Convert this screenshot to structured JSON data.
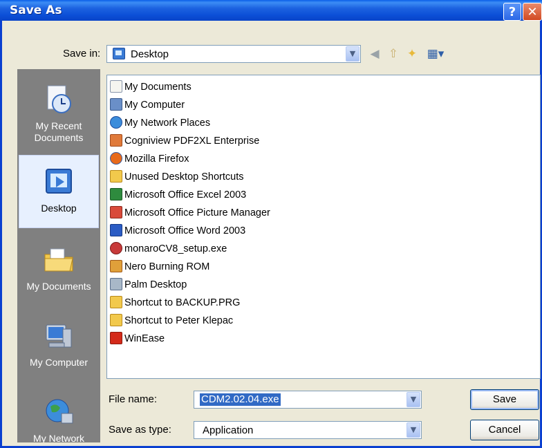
{
  "window": {
    "title": "Save As",
    "help_glyph": "?",
    "close_glyph": "✕"
  },
  "toolbar": {
    "save_in_label": "Save in:",
    "save_in_value": "Desktop",
    "icons": [
      "back-icon",
      "up-folder-icon",
      "new-folder-icon",
      "views-menu-icon"
    ]
  },
  "places": [
    {
      "label": "My Recent Documents",
      "icon": "recent-documents-icon"
    },
    {
      "label": "Desktop",
      "icon": "desktop-icon",
      "selected": true
    },
    {
      "label": "My Documents",
      "icon": "my-documents-icon"
    },
    {
      "label": "My Computer",
      "icon": "my-computer-icon"
    },
    {
      "label": "My Network",
      "icon": "my-network-icon"
    }
  ],
  "files": [
    {
      "name": "My Documents",
      "icon": "folder-documents-icon"
    },
    {
      "name": "My Computer",
      "icon": "computer-icon"
    },
    {
      "name": "My Network Places",
      "icon": "network-places-icon"
    },
    {
      "name": "Cogniview PDF2XL Enterprise",
      "icon": "shortcut-app-icon"
    },
    {
      "name": "Mozilla Firefox",
      "icon": "firefox-icon"
    },
    {
      "name": "Unused Desktop Shortcuts",
      "icon": "folder-icon"
    },
    {
      "name": "Microsoft Office Excel 2003",
      "icon": "excel-icon"
    },
    {
      "name": "Microsoft Office Picture Manager",
      "icon": "picture-manager-icon"
    },
    {
      "name": "Microsoft Office Word 2003",
      "icon": "word-icon"
    },
    {
      "name": "monaroCV8_setup.exe",
      "icon": "setup-exe-icon"
    },
    {
      "name": "Nero Burning ROM",
      "icon": "nero-icon"
    },
    {
      "name": "Palm Desktop",
      "icon": "palm-icon"
    },
    {
      "name": "Shortcut to BACKUP.PRG",
      "icon": "folder-shortcut-icon"
    },
    {
      "name": "Shortcut to Peter Klepac",
      "icon": "folder-shortcut-icon"
    },
    {
      "name": "WinEase",
      "icon": "winease-icon"
    }
  ],
  "footer": {
    "file_name_label": "File name:",
    "file_name_value": "CDM2.02.04.exe",
    "save_as_type_label": "Save as type:",
    "save_as_type_value": "Application",
    "save_label": "Save",
    "cancel_label": "Cancel"
  },
  "colors": {
    "titlebar": "#0B4ED6",
    "selection": "#316AC5",
    "places_bg": "#808080",
    "dialog_bg": "#ECE9D8"
  }
}
